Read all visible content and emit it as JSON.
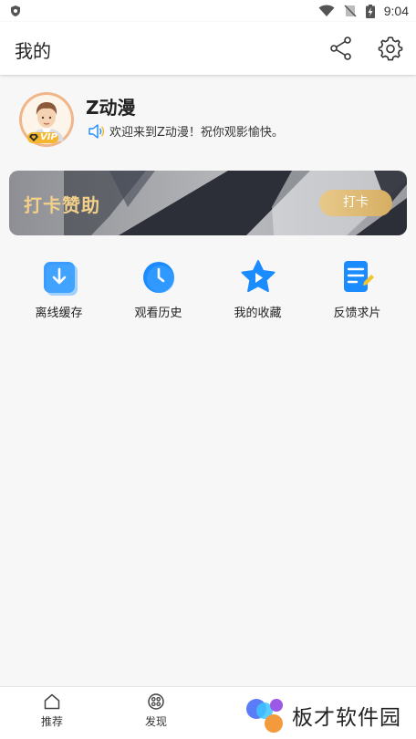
{
  "status_bar": {
    "time": "9:04"
  },
  "app_bar": {
    "title": "我的"
  },
  "profile": {
    "name": "Z动漫",
    "badge": "VIP",
    "welcome": "欢迎来到Z动漫！祝你观影愉快。"
  },
  "banner": {
    "label": "打卡赞助",
    "button": "打卡"
  },
  "quick_actions": [
    {
      "label": "离线缓存",
      "icon": "download-icon"
    },
    {
      "label": "观看历史",
      "icon": "clock-icon"
    },
    {
      "label": "我的收藏",
      "icon": "star-play-icon"
    },
    {
      "label": "反馈求片",
      "icon": "feedback-note-icon"
    }
  ],
  "bottom_nav": {
    "tabs": [
      {
        "label": "推荐",
        "icon": "home-icon"
      },
      {
        "label": "发现",
        "icon": "discover-icon"
      }
    ],
    "watermark": "板才软件园"
  },
  "colors": {
    "accent_blue": "#1a8cff",
    "gold": "#f2d08a"
  }
}
